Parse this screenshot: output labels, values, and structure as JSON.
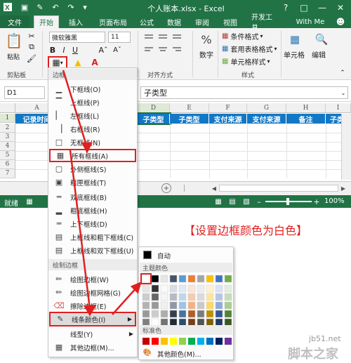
{
  "window": {
    "title": "个人账本.xlsx - Excel",
    "help": "?"
  },
  "tabs": [
    "文件",
    "开始",
    "插入",
    "页面布局",
    "公式",
    "数据",
    "审阅",
    "视图",
    "开发工具",
    "With Me"
  ],
  "ribbon": {
    "paste": "粘贴",
    "clipboard": "剪贴板",
    "font_name": "微软雅黑",
    "font_size": "11",
    "align_label": "对齐方式",
    "number": "数字",
    "styles_label": "样式",
    "cond": "条件格式",
    "table_fmt": "套用表格格式",
    "cell_style": "单元格样式",
    "cells": "单元格",
    "edit": "编辑"
  },
  "formula": {
    "namebox": "D1",
    "value": "子类型"
  },
  "columns": [
    "A",
    "B",
    "C",
    "D",
    "E",
    "F",
    "G",
    "H",
    "I"
  ],
  "header_row": [
    "记录时间",
    "子类型",
    "子类型",
    "支付来源",
    "支付来源",
    "备注",
    "子类"
  ],
  "rows": [
    "1",
    "2",
    "3",
    "4",
    "5",
    "6",
    "7",
    "8"
  ],
  "status": {
    "ready": "就绪",
    "zoom": "100%"
  },
  "annotation": "【设置边框颜色为白色】",
  "border_menu": {
    "head1": "边框",
    "items1": [
      "下框线(O)",
      "上框线(P)",
      "左框线(L)",
      "右框线(R)",
      "无框线(N)",
      "所有框线(A)",
      "外侧框线(S)",
      "粗匣框线(T)",
      "双底框线(B)",
      "粗底框线(H)",
      "上下框线(D)",
      "上框线和粗下框线(C)",
      "上框线和双下框线(U)"
    ],
    "head2": "绘制边框",
    "items2": [
      "绘图边框(W)",
      "绘图边框网格(G)",
      "擦除边框(E)",
      "线条颜色(I)",
      "线型(Y)",
      "其他边框(M)..."
    ]
  },
  "color_menu": {
    "auto": "自动",
    "theme": "主题颜色",
    "standard": "标准色",
    "more": "其他颜色(M)..."
  },
  "theme_top": [
    "#ffffff",
    "#000000",
    "#e7e6e6",
    "#44546a",
    "#5b9bd5",
    "#ed7d31",
    "#a5a5a5",
    "#ffc000",
    "#4472c4",
    "#70ad47"
  ],
  "standard_colors": [
    "#c00000",
    "#ff0000",
    "#ffc000",
    "#ffff00",
    "#92d050",
    "#00b050",
    "#00b0f0",
    "#0070c0",
    "#002060",
    "#7030a0"
  ],
  "watermark": {
    "site": "jb51.net",
    "brand": "脚本之家"
  }
}
